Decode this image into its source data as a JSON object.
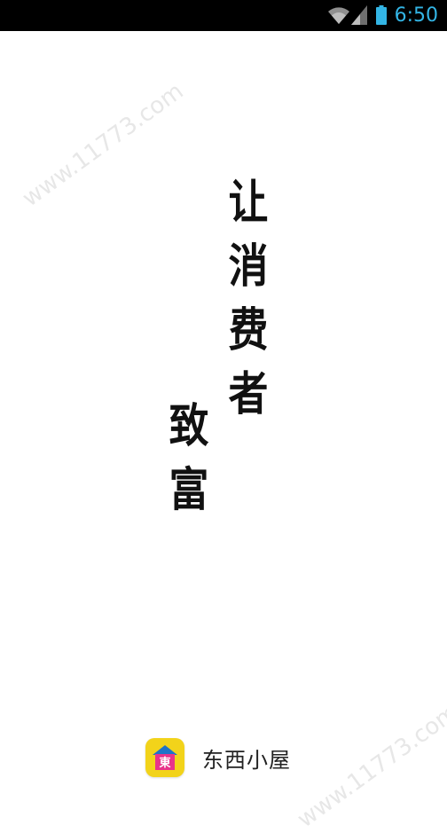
{
  "status_bar": {
    "time": "6:50",
    "time_color": "#33b5e5",
    "icons": [
      "wifi-icon",
      "signal-icon",
      "battery-icon"
    ]
  },
  "splash": {
    "slogan_main": [
      "让",
      "消",
      "费",
      "者"
    ],
    "slogan_sub": [
      "致",
      "富"
    ],
    "watermark": "www.11773.com",
    "brand_name": "东西小屋",
    "brand_logo_char": "東",
    "colors": {
      "logo_bg": "#f2d31a",
      "logo_roof": "#1e73c8",
      "logo_house": "#e8338a",
      "text": "#111111"
    }
  }
}
